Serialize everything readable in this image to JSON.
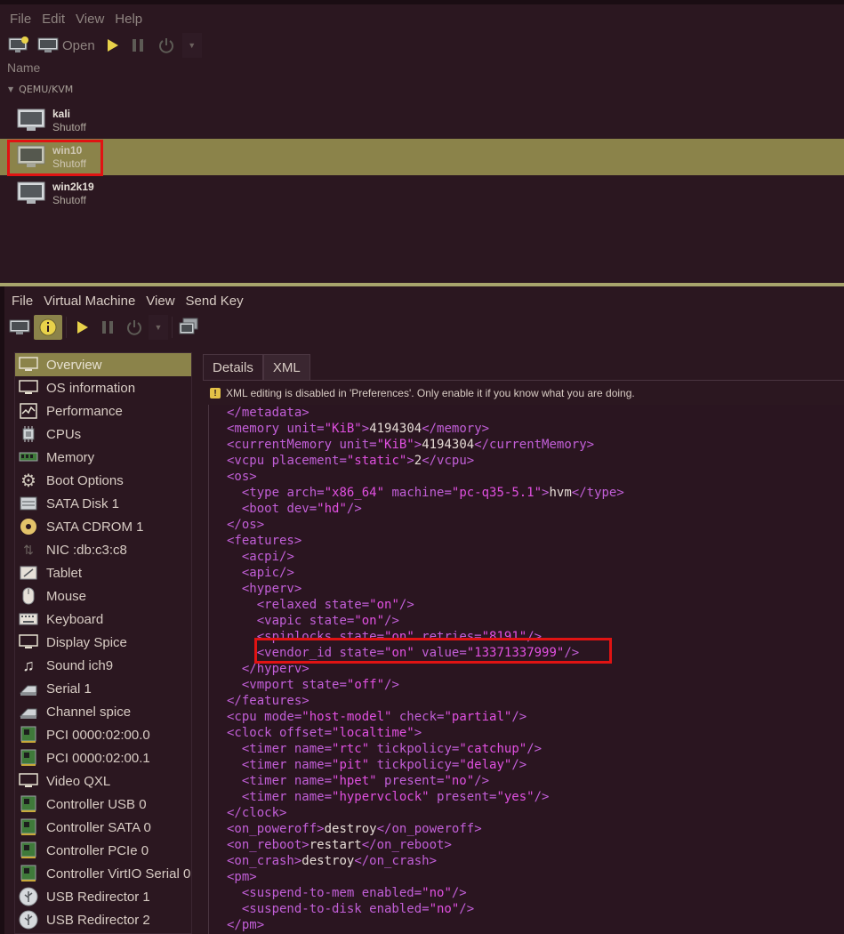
{
  "manager": {
    "menu": [
      "File",
      "Edit",
      "View",
      "Help"
    ],
    "toolbar": {
      "open_label": "Open"
    },
    "column_header": "Name",
    "group": "QEMU/KVM",
    "vms": [
      {
        "name": "kali",
        "status": "Shutoff",
        "selected": false
      },
      {
        "name": "win10",
        "status": "Shutoff",
        "selected": true
      },
      {
        "name": "win2k19",
        "status": "Shutoff",
        "selected": false
      }
    ]
  },
  "details": {
    "menu": [
      "File",
      "Virtual Machine",
      "View",
      "Send Key"
    ],
    "sidebar": [
      {
        "label": "Overview",
        "icon": "monitor-icon",
        "selected": true
      },
      {
        "label": "OS information",
        "icon": "monitor-icon"
      },
      {
        "label": "Performance",
        "icon": "chart-icon"
      },
      {
        "label": "CPUs",
        "icon": "cpu-icon"
      },
      {
        "label": "Memory",
        "icon": "memory-icon"
      },
      {
        "label": "Boot Options",
        "icon": "gear-icon"
      },
      {
        "label": "SATA Disk 1",
        "icon": "disk-icon"
      },
      {
        "label": "SATA CDROM 1",
        "icon": "cdrom-icon"
      },
      {
        "label": "NIC :db:c3:c8",
        "icon": "network-icon"
      },
      {
        "label": "Tablet",
        "icon": "tablet-icon"
      },
      {
        "label": "Mouse",
        "icon": "mouse-icon"
      },
      {
        "label": "Keyboard",
        "icon": "keyboard-icon"
      },
      {
        "label": "Display Spice",
        "icon": "monitor-icon"
      },
      {
        "label": "Sound ich9",
        "icon": "sound-icon"
      },
      {
        "label": "Serial 1",
        "icon": "serial-icon"
      },
      {
        "label": "Channel spice",
        "icon": "channel-icon"
      },
      {
        "label": "PCI 0000:02:00.0",
        "icon": "pci-card-icon"
      },
      {
        "label": "PCI 0000:02:00.1",
        "icon": "pci-card-icon"
      },
      {
        "label": "Video QXL",
        "icon": "monitor-icon"
      },
      {
        "label": "Controller USB 0",
        "icon": "pci-card-icon"
      },
      {
        "label": "Controller SATA 0",
        "icon": "pci-card-icon"
      },
      {
        "label": "Controller PCIe 0",
        "icon": "pci-card-icon"
      },
      {
        "label": "Controller VirtIO Serial 0",
        "icon": "pci-card-icon"
      },
      {
        "label": "USB Redirector 1",
        "icon": "usb-icon"
      },
      {
        "label": "USB Redirector 2",
        "icon": "usb-icon"
      }
    ],
    "tabs": [
      "Details",
      "XML"
    ],
    "active_tab": "XML",
    "warning": "XML editing is disabled in 'Preferences'. Only enable it if you know what you are doing.",
    "xml_lines": [
      "</metadata>",
      "<memory unit=\"KiB\">4194304</memory>",
      "<currentMemory unit=\"KiB\">4194304</currentMemory>",
      "<vcpu placement=\"static\">2</vcpu>",
      "<os>",
      "  <type arch=\"x86_64\" machine=\"pc-q35-5.1\">hvm</type>",
      "  <boot dev=\"hd\"/>",
      "</os>",
      "<features>",
      "  <acpi/>",
      "  <apic/>",
      "  <hyperv>",
      "    <relaxed state=\"on\"/>",
      "    <vapic state=\"on\"/>",
      "    <spinlocks state=\"on\" retries=\"8191\"/>",
      "    <vendor_id state=\"on\" value=\"13371337999\"/>",
      "  </hyperv>",
      "  <vmport state=\"off\"/>",
      "</features>",
      "<cpu mode=\"host-model\" check=\"partial\"/>",
      "<clock offset=\"localtime\">",
      "  <timer name=\"rtc\" tickpolicy=\"catchup\"/>",
      "  <timer name=\"pit\" tickpolicy=\"delay\"/>",
      "  <timer name=\"hpet\" present=\"no\"/>",
      "  <timer name=\"hypervclock\" present=\"yes\"/>",
      "</clock>",
      "<on_poweroff>destroy</on_poweroff>",
      "<on_reboot>restart</on_reboot>",
      "<on_crash>destroy</on_crash>",
      "<pm>",
      "  <suspend-to-mem enabled=\"no\"/>",
      "  <suspend-to-disk enabled=\"no\"/>",
      "</pm>"
    ],
    "highlighted_line": 15
  },
  "colors": {
    "background": "#2b1720",
    "selection": "#8b834a",
    "highlight_box": "#e01313",
    "xml_tag": "#c25fd8",
    "xml_value": "#e050e0"
  }
}
